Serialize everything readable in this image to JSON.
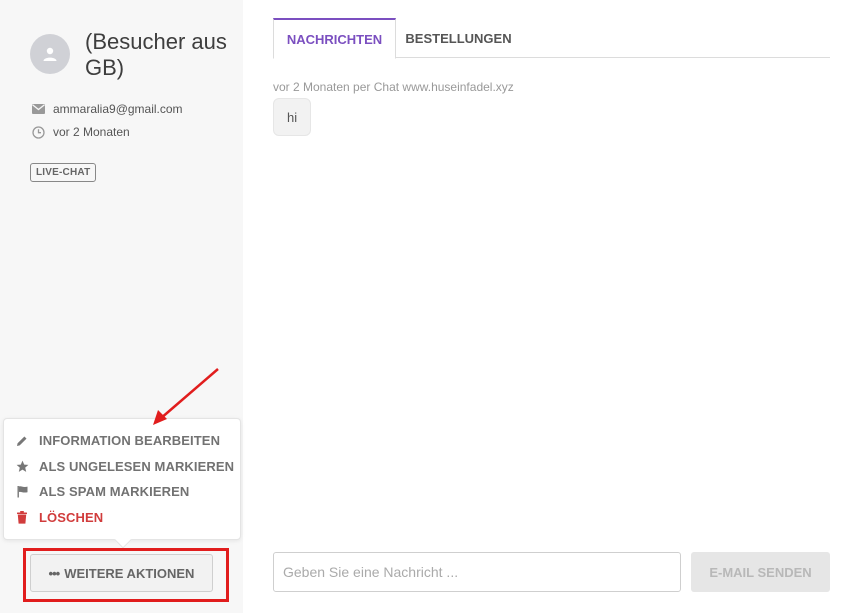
{
  "visitor": {
    "name": "(Besucher aus GB)",
    "email": "ammaralia9@gmail.com",
    "last_seen": "vor 2 Monaten",
    "badge": "LIVE-CHAT"
  },
  "actions_menu": {
    "items": [
      {
        "label": "INFORMATION BEARBEITEN",
        "icon": "pencil-icon"
      },
      {
        "label": "ALS UNGELESEN MARKIEREN",
        "icon": "star-icon"
      },
      {
        "label": "ALS SPAM MARKIEREN",
        "icon": "flag-icon"
      },
      {
        "label": "LÖSCHEN",
        "icon": "trash-icon",
        "color": "#d13c3c"
      }
    ],
    "more_button_label": "WEITERE AKTIONEN"
  },
  "tabs": [
    {
      "label": "NACHRICHTEN",
      "active": true
    },
    {
      "label": "BESTELLUNGEN",
      "active": false
    }
  ],
  "conversation": {
    "meta": "vor 2 Monaten per Chat www.huseinfadel.xyz",
    "messages": [
      {
        "text": "hi"
      }
    ]
  },
  "composer": {
    "placeholder": "Geben Sie eine Nachricht ...",
    "send_label": "E-MAIL SENDEN"
  },
  "colors": {
    "accent": "#7b4fc0",
    "danger": "#d13c3c",
    "annotation": "#e11d1d"
  }
}
